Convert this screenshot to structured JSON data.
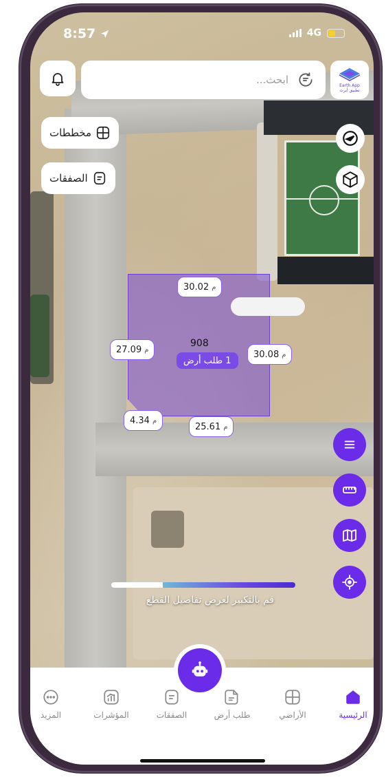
{
  "status_bar": {
    "time": "8:57",
    "network": "4G",
    "battery_level": 0.45
  },
  "search": {
    "placeholder": "ابحث..."
  },
  "logo": {
    "title": "Earth App",
    "subtitle": "تطبيق أيرث"
  },
  "map_buttons": {
    "plans": "مخططات",
    "deals": "الصفقات"
  },
  "parcel": {
    "id": "908",
    "request_label": "1 طلب أرض",
    "unit": "م",
    "dimensions": {
      "top": "30.02",
      "left": "27.09",
      "right": "30.08",
      "corner": "4.34",
      "bottom": "25.61"
    }
  },
  "zoom_hint": "قم بالتكبير لعرض تفاصيل القطع",
  "nav": {
    "home": "الرئيسية",
    "lands": "الأراضي",
    "land_request": "طلب أرض",
    "deals": "الصفقات",
    "indicators": "المؤشرات",
    "more": "المزيد"
  },
  "colors": {
    "accent": "#6a2ce8",
    "parcel_fill": "#7a4ed6",
    "battery": "#f5cf2a"
  }
}
